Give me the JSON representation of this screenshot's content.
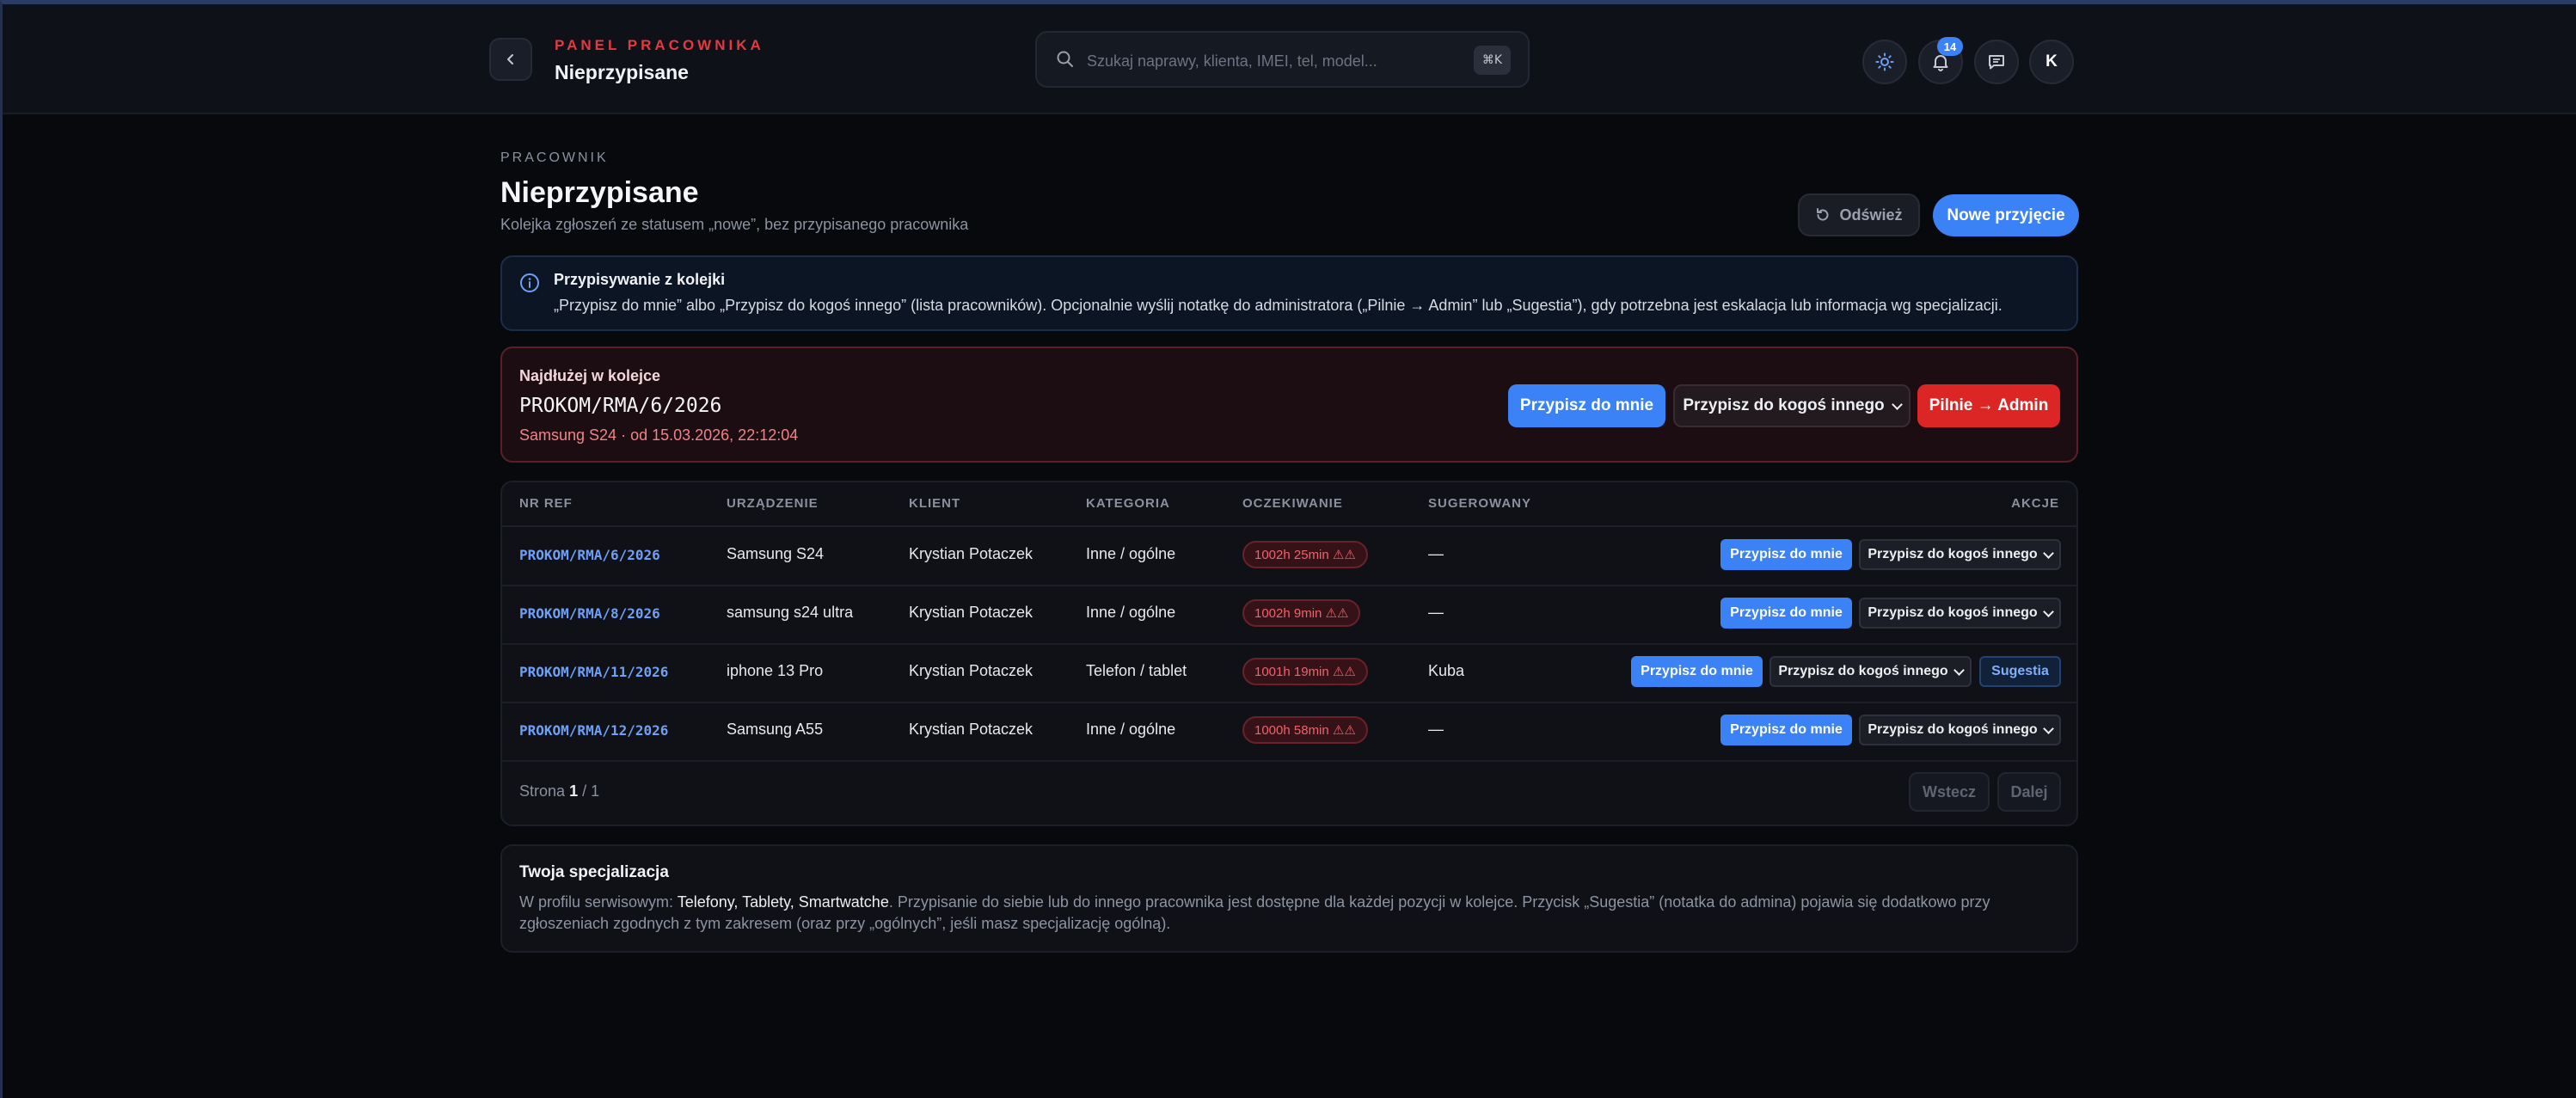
{
  "header": {
    "eyebrow": "PANEL PRACOWNIKA",
    "title": "Nieprzypisane",
    "search_placeholder": "Szukaj naprawy, klienta, IMEI, tel, model...",
    "search_shortcut": "⌘K",
    "notifications_count": "14",
    "avatar_initial": "K",
    "icons": [
      "back-icon",
      "search-icon",
      "theme-icon",
      "bell-icon",
      "chat-icon"
    ]
  },
  "page": {
    "eyebrow": "PRACOWNIK",
    "title": "Nieprzypisane",
    "subtitle": "Kolejka zgłoszeń ze statusem „nowe”, bez przypisanego pracownika",
    "refresh_label": "Odśwież",
    "new_label": "Nowe przyjęcie"
  },
  "info": {
    "title": "Przypisywanie z kolejki",
    "text": "„Przypisz do mnie” albo „Przypisz do kogoś innego” (lista pracowników). Opcjonalnie wyślij notatkę do administratora („Pilnie → Admin” lub „Sugestia”), gdy potrzebna jest eskalacja lub informacja wg specjalizacji."
  },
  "longest": {
    "label": "Najdłużej w kolejce",
    "ref": "PROKOM/RMA/6/2026",
    "meta": "Samsung S24 · od 15.03.2026, 22:12:04",
    "assign_me": "Przypisz do mnie",
    "assign_other": "Przypisz do kogoś innego",
    "urgent": "Pilnie → Admin"
  },
  "table": {
    "columns": {
      "ref": "NR REF",
      "device": "URZĄDZENIE",
      "client": "KLIENT",
      "category": "KATEGORIA",
      "wait": "OCZEKIWANIE",
      "suggested": "SUGEROWANY",
      "actions": "AKCJE"
    },
    "assign_me": "Przypisz do mnie",
    "assign_other": "Przypisz do kogoś innego",
    "suggest": "Sugestia",
    "rows": [
      {
        "ref": "PROKOM/RMA/6/2026",
        "device": "Samsung S24",
        "client": "Krystian Potaczek",
        "category": "Inne / ogólne",
        "wait": "1002h 25min ⚠⚠",
        "suggested": "—"
      },
      {
        "ref": "PROKOM/RMA/8/2026",
        "device": "samsung s24 ultra",
        "client": "Krystian Potaczek",
        "category": "Inne / ogólne",
        "wait": "1002h 9min ⚠⚠",
        "suggested": "—"
      },
      {
        "ref": "PROKOM/RMA/11/2026",
        "device": "iphone 13 Pro",
        "client": "Krystian Potaczek",
        "category": "Telefon / tablet",
        "wait": "1001h 19min ⚠⚠",
        "suggested": "Kuba"
      },
      {
        "ref": "PROKOM/RMA/12/2026",
        "device": "Samsung A55",
        "client": "Krystian Potaczek",
        "category": "Inne / ogólne",
        "wait": "1000h 58min ⚠⚠",
        "suggested": "—"
      }
    ],
    "pager": {
      "prefix": "Strona",
      "current": "1",
      "total": "/ 1",
      "prev": "Wstecz",
      "next": "Dalej"
    }
  },
  "spec": {
    "title": "Twoja specjalizacja",
    "text_before": "W profilu serwisowym: ",
    "specializations": "Telefony, Tablety, Smartwatche",
    "text_after": ". Przypisanie do siebie lub do innego pracownika jest dostępne dla każdej pozycji w kolejce. Przycisk „Sugestia” (notatka do admina) pojawia się dodatkowo przy zgłoszeniach zgodnych z tym zakresem (oraz przy „ogólnych”, jeśli masz specjalizację ogólną)."
  },
  "colors": {
    "accent": "#3b82f6",
    "danger": "#dc2626",
    "brand": "#e5393f",
    "background": "#08090d"
  }
}
